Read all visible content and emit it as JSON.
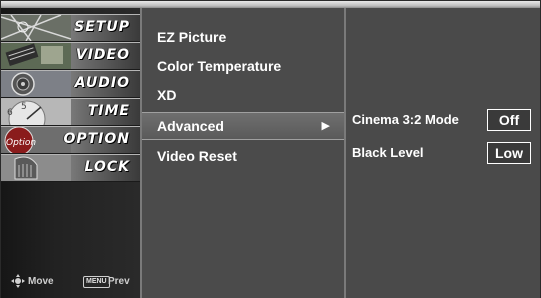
{
  "categories": [
    {
      "label": "SETUP",
      "icon": "setup-thumbnail-icon"
    },
    {
      "label": "VIDEO",
      "icon": "video-thumbnail-icon"
    },
    {
      "label": "AUDIO",
      "icon": "audio-thumbnail-icon"
    },
    {
      "label": "TIME",
      "icon": "clock-thumbnail-icon"
    },
    {
      "label": "OPTION",
      "icon": "option-thumbnail-icon",
      "thumb_text": "Option"
    },
    {
      "label": "LOCK",
      "icon": "lock-thumbnail-icon"
    }
  ],
  "nav_hint": {
    "move_label": "Move",
    "menu_key": "MENU",
    "prev_label": "Prev"
  },
  "submenu": {
    "items": [
      {
        "label": "EZ Picture"
      },
      {
        "label": "Color Temperature"
      },
      {
        "label": "XD"
      },
      {
        "label": "Advanced",
        "selected": true,
        "arrow": "▶"
      },
      {
        "label": "Video Reset"
      }
    ]
  },
  "settings": [
    {
      "label": "Cinema 3:2 Mode",
      "value": "Off"
    },
    {
      "label": "Black Level",
      "value": "Low"
    }
  ],
  "colors": {
    "panel": "#4a4a4a",
    "selected_row": "#666666",
    "text": "#ffffff"
  }
}
